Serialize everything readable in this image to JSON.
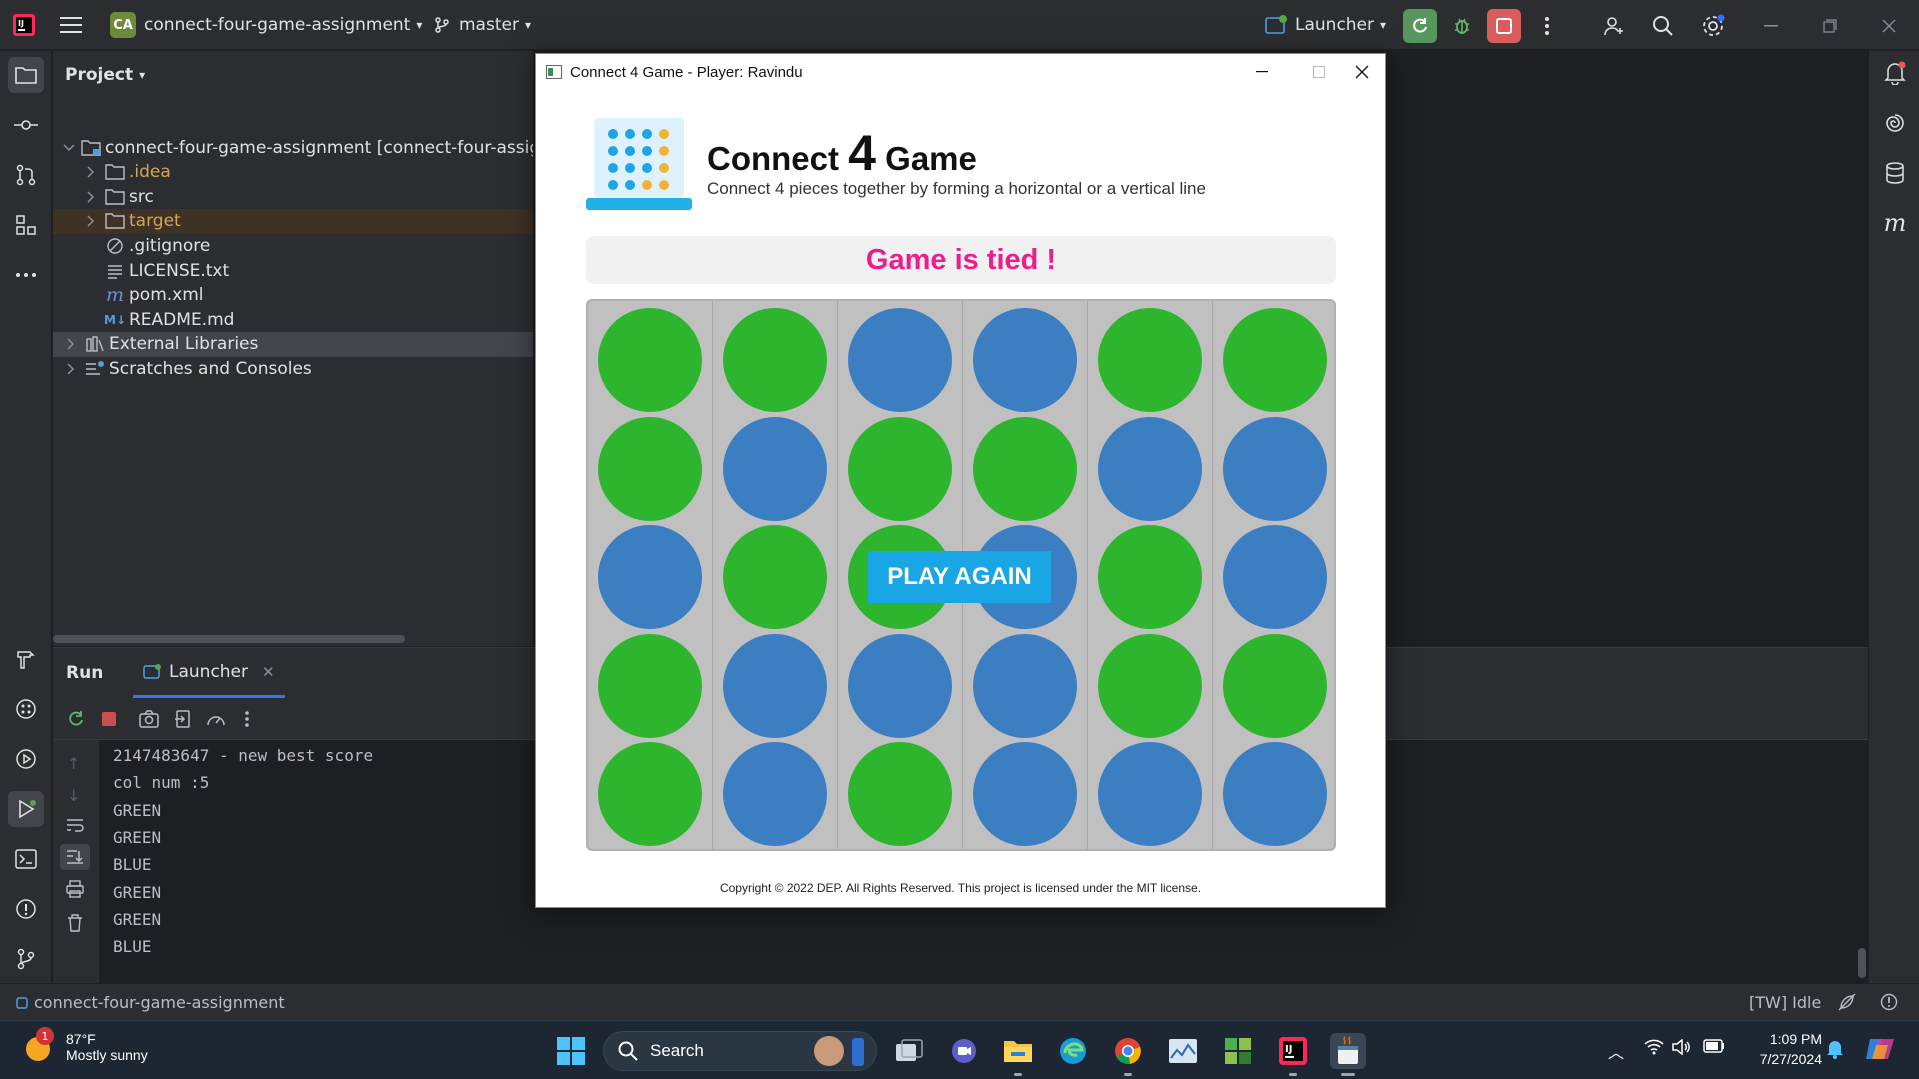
{
  "ide": {
    "project_badge": "CA",
    "project_name": "connect-four-game-assignment",
    "branch": "master",
    "run_config": "Launcher"
  },
  "project_panel": {
    "title": "Project",
    "tree": [
      {
        "label": "connect-four-game-assignment [connect-four-assig",
        "icon": "module-folder-icon",
        "depth": 0,
        "expanded": true
      },
      {
        "label": ".idea",
        "icon": "folder-icon",
        "depth": 1
      },
      {
        "label": "src",
        "icon": "folder-icon",
        "depth": 1
      },
      {
        "label": "target",
        "icon": "folder-icon",
        "depth": 1,
        "highlight": "excluded"
      },
      {
        "label": ".gitignore",
        "icon": "ignore-file-icon",
        "depth": 1
      },
      {
        "label": "LICENSE.txt",
        "icon": "text-file-icon",
        "depth": 1
      },
      {
        "label": "pom.xml",
        "icon": "maven-icon",
        "depth": 1
      },
      {
        "label": "README.md",
        "icon": "markdown-icon",
        "depth": 1
      },
      {
        "label": "External Libraries",
        "icon": "library-icon",
        "depth": 0,
        "selected": true
      },
      {
        "label": "Scratches and Consoles",
        "icon": "scratches-icon",
        "depth": 0
      }
    ]
  },
  "run_panel": {
    "run_tab": "Run",
    "launcher_tab": "Launcher",
    "console": [
      "2147483647 - new best score",
      "col num :5",
      "GREEN",
      "GREEN",
      "BLUE",
      "GREEN",
      "GREEN",
      "BLUE"
    ]
  },
  "status_bar": {
    "project": "connect-four-game-assignment",
    "state": "[TW] Idle"
  },
  "game": {
    "window_title": "Connect 4 Game - Player: Ravindu",
    "title_prefix": "Connect ",
    "title_number": "4",
    "title_suffix": " Game",
    "subtitle": "Connect 4 pieces together by forming a horizontal or a vertical line",
    "status": "Game is tied !",
    "play_again": "PLAY AGAIN",
    "footer": "Copyright © 2022 DEP. All Rights Reserved. This project is licensed under the MIT license.",
    "colors": {
      "green": "#2db52d",
      "blue": "#3b7ec2",
      "status": "#ea1f8b",
      "button": "#1aa6e4"
    },
    "board": [
      [
        "green",
        "green",
        "blue",
        "blue",
        "green",
        "green"
      ],
      [
        "green",
        "blue",
        "green",
        "green",
        "blue",
        "blue"
      ],
      [
        "blue",
        "green",
        "green",
        "blue",
        "green",
        "blue"
      ],
      [
        "green",
        "blue",
        "blue",
        "blue",
        "green",
        "green"
      ],
      [
        "green",
        "blue",
        "green",
        "blue",
        "blue",
        "blue"
      ]
    ]
  },
  "taskbar": {
    "weather_temp": "87°F",
    "weather_desc": "Mostly sunny",
    "weather_badge": "1",
    "search": "Search",
    "time": "1:09 PM",
    "date": "7/27/2024"
  }
}
